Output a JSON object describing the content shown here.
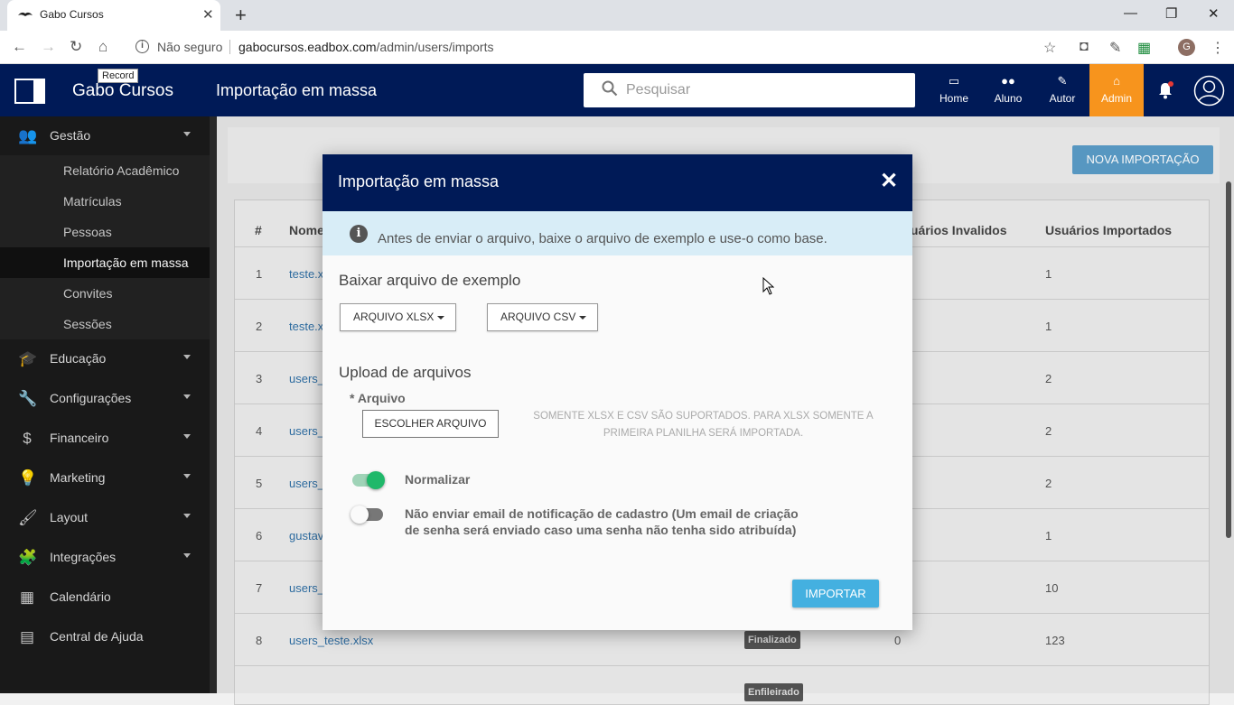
{
  "browser": {
    "tab_title": "Gabo Cursos",
    "tab_close": "✕",
    "new_tab": "+",
    "not_secure": "Não seguro",
    "url_host": "gabocursos.eadbox.com",
    "url_path": "/admin/users/imports",
    "profile_initial": "G",
    "window_buttons": [
      "—",
      "❐",
      "✕"
    ]
  },
  "header": {
    "brand": "Gabo Cursos",
    "record_tooltip": "Record",
    "page_title": "Importação em massa",
    "search_placeholder": "Pesquisar",
    "nav": [
      {
        "label": "Home",
        "icon": "laptop-icon"
      },
      {
        "label": "Aluno",
        "icon": "people-icon"
      },
      {
        "label": "Autor",
        "icon": "pencil-icon"
      },
      {
        "label": "Admin",
        "icon": "bank-icon"
      }
    ],
    "accent": "#f7941d",
    "bg": "#001a57"
  },
  "sidebar": {
    "sections": [
      {
        "label": "Gestão",
        "icon": "people-icon"
      },
      {
        "label": "Educação",
        "icon": "graduation-cap-icon"
      },
      {
        "label": "Configurações",
        "icon": "wrench-icon"
      },
      {
        "label": "Financeiro",
        "icon": "dollar-icon"
      },
      {
        "label": "Marketing",
        "icon": "lightbulb-icon"
      },
      {
        "label": "Layout",
        "icon": "brush-icon"
      },
      {
        "label": "Integrações",
        "icon": "puzzle-icon"
      },
      {
        "label": "Calendário",
        "icon": "calendar-icon"
      },
      {
        "label": "Central de Ajuda",
        "icon": "chat-icon"
      }
    ],
    "gestao_items": [
      "Relatório Acadêmico",
      "Matrículas",
      "Pessoas",
      "Importação em massa",
      "Convites",
      "Sessões"
    ],
    "active_item": "Importação em massa"
  },
  "main": {
    "new_import_button": "NOVA IMPORTAÇÃO",
    "columns": [
      "#",
      "Nome",
      "Usuários Invalidos",
      "Usuários Importados"
    ],
    "rows": [
      {
        "num": "1",
        "name": "teste.x",
        "invalid": "",
        "imported": "1"
      },
      {
        "num": "2",
        "name": "teste.x",
        "invalid": "",
        "imported": "1"
      },
      {
        "num": "3",
        "name": "users_",
        "invalid": "",
        "imported": "2"
      },
      {
        "num": "4",
        "name": "users_",
        "invalid": "",
        "imported": "2"
      },
      {
        "num": "5",
        "name": "users_",
        "invalid": "",
        "imported": "2"
      },
      {
        "num": "6",
        "name": "gustav",
        "invalid": "",
        "imported": "1"
      },
      {
        "num": "7",
        "name": "users_",
        "invalid": "",
        "imported": "10"
      },
      {
        "num": "8",
        "name": "users_teste.xlsx",
        "status": "Finalizado",
        "invalid": "0",
        "imported": "123"
      }
    ],
    "last_row_status": "Enfileirado"
  },
  "modal": {
    "title": "Importação em massa",
    "close": "✕",
    "alert_text": "Antes de enviar o arquivo, baixe o arquivo de exemplo e use-o como base.",
    "download_heading": "Baixar arquivo de exemplo",
    "xlsx_button": "ARQUIVO XLSX",
    "csv_button": "ARQUIVO CSV",
    "upload_heading": "Upload de arquivos",
    "file_label": "* Arquivo",
    "choose_button": "ESCOLHER ARQUIVO",
    "hint": "SOMENTE XLSX E CSV SÃO SUPORTADOS. PARA XLSX SOMENTE A PRIMEIRA PLANILHA SERÁ IMPORTADA.",
    "normalize_label": "Normalizar",
    "normalize_on": true,
    "no_email_label": "Não enviar email de notificação de cadastro (Um email de criação de senha será enviado caso uma senha não tenha sido atribuída)",
    "no_email_on": false,
    "import_button": "IMPORTAR"
  }
}
